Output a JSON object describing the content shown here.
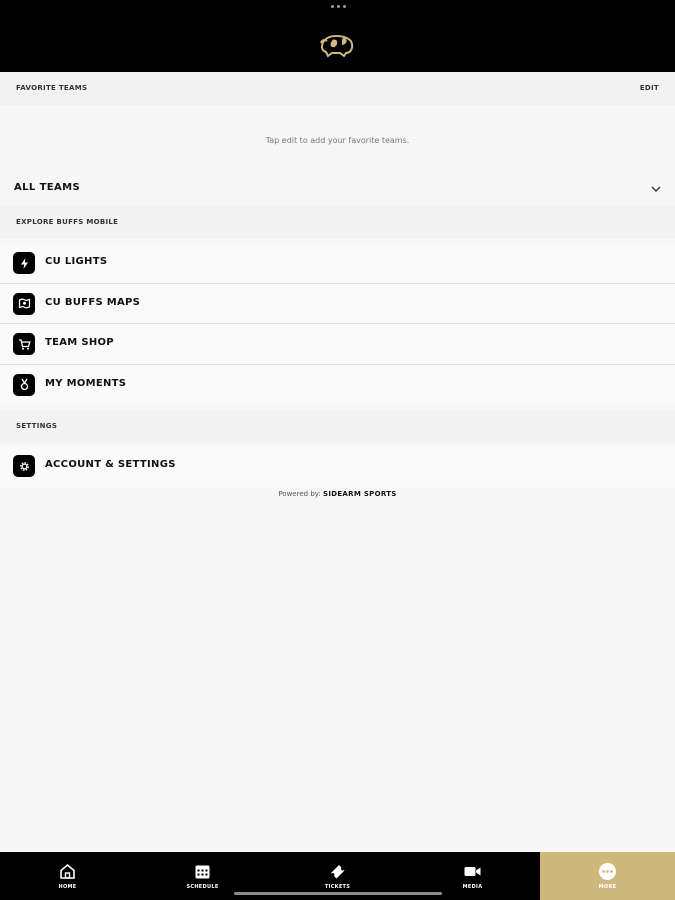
{
  "header": {
    "logo": "cu-buffalo-logo",
    "accent": "#cfb87c"
  },
  "favorites": {
    "heading": "FAVORITE TEAMS",
    "edit_label": "EDIT",
    "empty_hint": "Tap edit to add your favorite teams."
  },
  "all_teams": {
    "label": "ALL TEAMS"
  },
  "explore": {
    "heading": "EXPLORE BUFFS MOBILE",
    "items": [
      {
        "label": "CU LIGHTS",
        "icon": "lightning-icon"
      },
      {
        "label": "CU BUFFS MAPS",
        "icon": "map-icon"
      },
      {
        "label": "TEAM SHOP",
        "icon": "cart-icon"
      },
      {
        "label": "MY MOMENTS",
        "icon": "medal-icon"
      }
    ]
  },
  "settings": {
    "heading": "SETTINGS",
    "items": [
      {
        "label": "ACCOUNT & SETTINGS",
        "icon": "gear-icon"
      }
    ]
  },
  "footer": {
    "powered_prefix": "Powered by:",
    "powered_brand": "SIDEARM SPORTS"
  },
  "tabbar": {
    "tabs": [
      {
        "label": "HOME",
        "icon": "home-icon"
      },
      {
        "label": "SCHEDULE",
        "icon": "calendar-icon"
      },
      {
        "label": "TICKETS",
        "icon": "ticket-icon"
      },
      {
        "label": "MEDIA",
        "icon": "video-icon"
      },
      {
        "label": "MORE",
        "icon": "more-icon"
      }
    ],
    "active": "MORE"
  }
}
